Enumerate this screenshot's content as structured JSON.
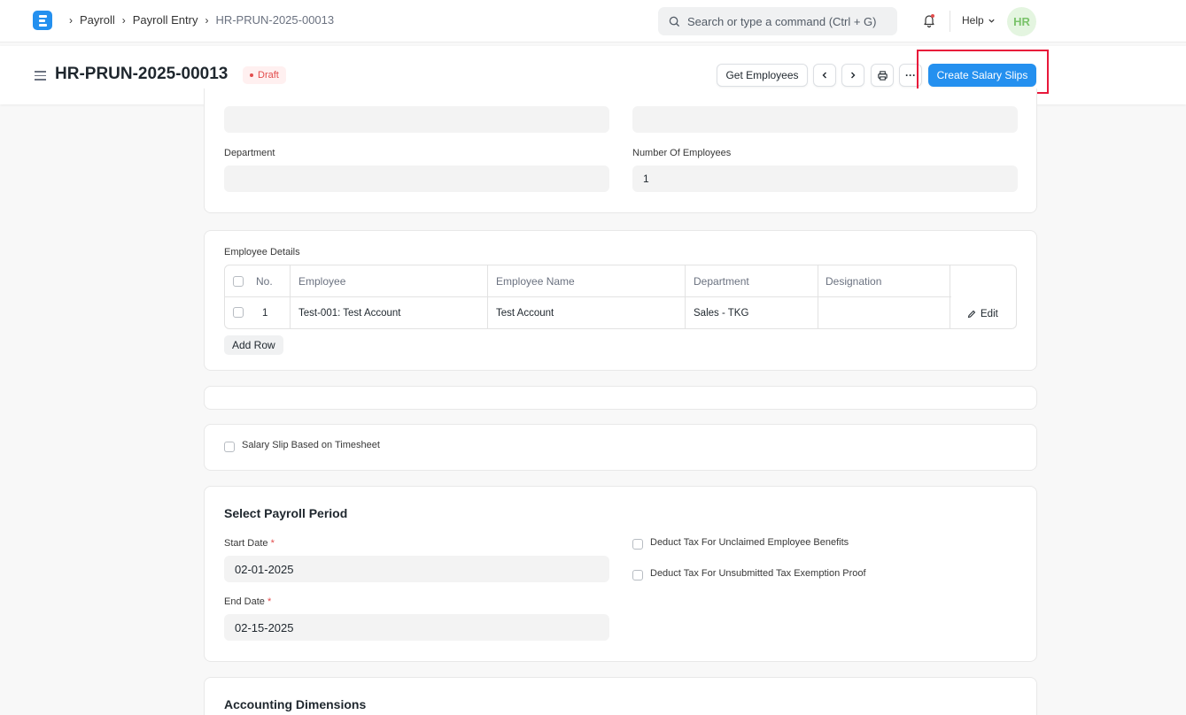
{
  "navbar": {
    "breadcrumbs": [
      "Payroll",
      "Payroll Entry",
      "HR-PRUN-2025-00013"
    ],
    "search_placeholder": "Search or type a command (Ctrl + G)",
    "help_label": "Help",
    "avatar_initials": "HR"
  },
  "page": {
    "title": "HR-PRUN-2025-00013",
    "status": "Draft",
    "get_employees_label": "Get Employees",
    "more_label": "···",
    "create_salary_slips_label": "Create Salary Slips"
  },
  "filters": {
    "department_label": "Department",
    "department_value": "",
    "number_of_employees_label": "Number Of Employees",
    "number_of_employees_value": "1"
  },
  "employee_details": {
    "label": "Employee Details",
    "columns": [
      "No.",
      "Employee",
      "Employee Name",
      "Department",
      "Designation"
    ],
    "rows": [
      {
        "no": "1",
        "employee": "Test-001: Test Account",
        "employee_name": "Test Account",
        "department": "Sales - TKG",
        "designation": ""
      }
    ],
    "edit_label": "Edit",
    "add_row_label": "Add Row"
  },
  "timesheet": {
    "label": "Salary Slip Based on Timesheet"
  },
  "payroll_period": {
    "title": "Select Payroll Period",
    "start_date_label": "Start Date",
    "start_date_value": "02-01-2025",
    "end_date_label": "End Date",
    "end_date_value": "02-15-2025",
    "required_mark": "*",
    "deduct_unclaimed_label": "Deduct Tax For Unclaimed Employee Benefits",
    "deduct_unsubmitted_label": "Deduct Tax For Unsubmitted Tax Exemption Proof"
  },
  "accounting": {
    "title": "Accounting Dimensions"
  },
  "colors": {
    "primary": "#2490ef",
    "draft": "#e24c4c",
    "highlight": "#e8183a"
  }
}
